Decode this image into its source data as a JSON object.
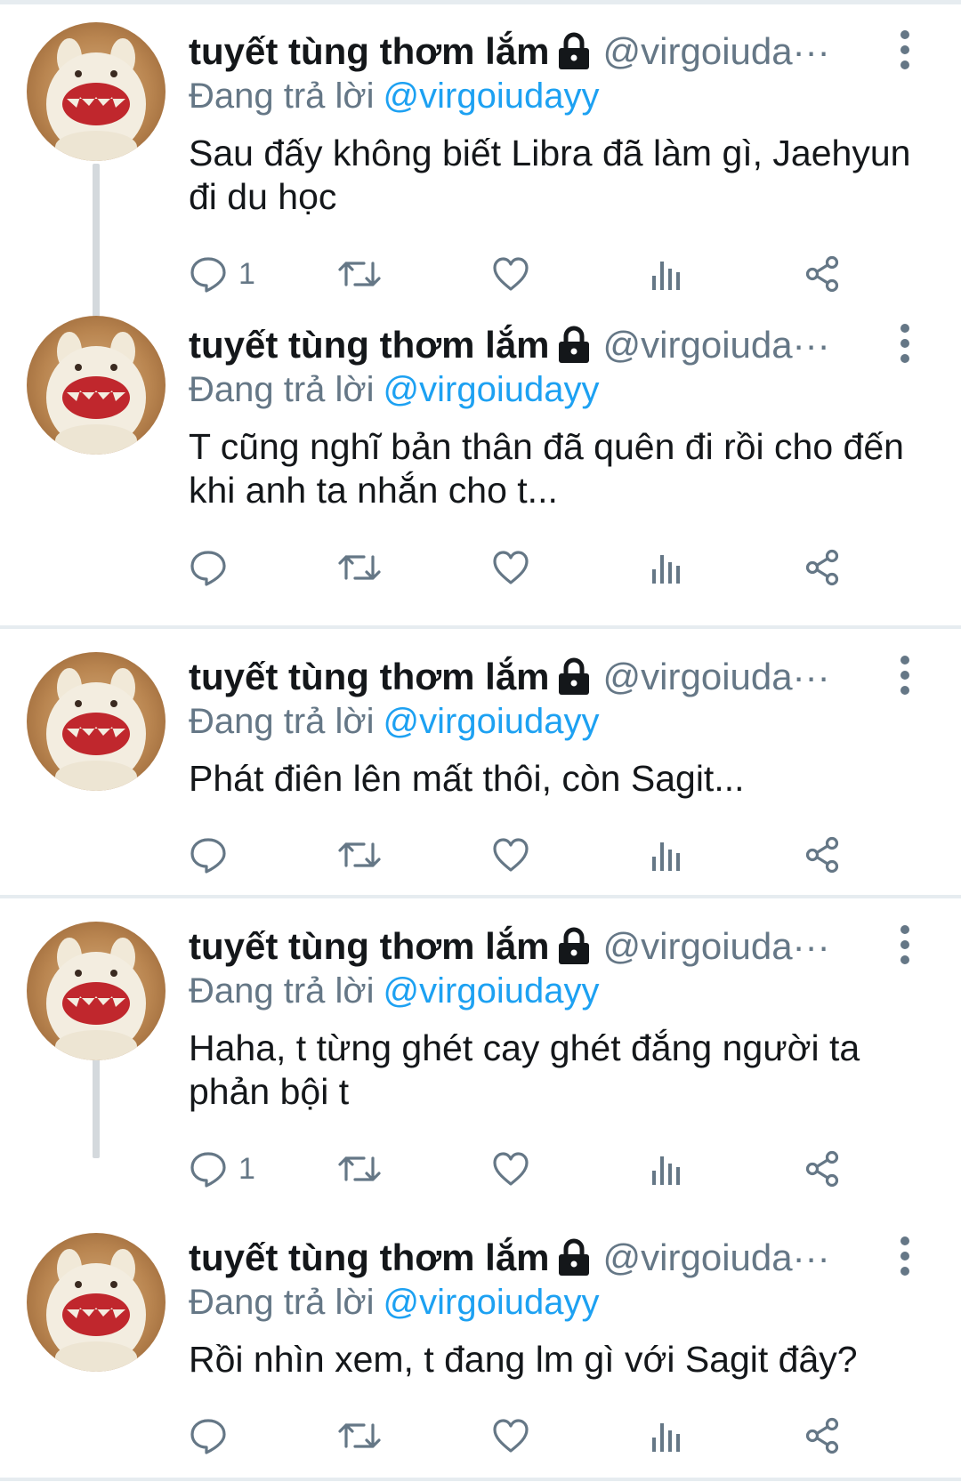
{
  "tweets": [
    {
      "name": "tuyết tùng thơm lắm",
      "handle": "@virgoiuda···",
      "reply_prefix": "Đang trả lời",
      "reply_mention": "@virgoiudayy",
      "text": "Sau đấy không biết Libra đã làm gì, Jaehyun đi du học",
      "reply_count": "1"
    },
    {
      "name": "tuyết tùng thơm lắm",
      "handle": "@virgoiuda···",
      "reply_prefix": "Đang trả lời",
      "reply_mention": "@virgoiudayy",
      "text": "T cũng nghĩ bản thân đã quên đi rồi cho đến khi anh ta nhắn cho t...",
      "reply_count": ""
    },
    {
      "name": "tuyết tùng thơm lắm",
      "handle": "@virgoiuda···",
      "reply_prefix": "Đang trả lời",
      "reply_mention": "@virgoiudayy",
      "text": "Phát điên lên mất thôi, còn Sagit...",
      "reply_count": ""
    },
    {
      "name": "tuyết tùng thơm lắm",
      "handle": "@virgoiuda···",
      "reply_prefix": "Đang trả lời",
      "reply_mention": "@virgoiudayy",
      "text": "Haha, t từng ghét cay ghét đắng người ta phản bội t",
      "reply_count": "1"
    },
    {
      "name": "tuyết tùng thơm lắm",
      "handle": "@virgoiuda···",
      "reply_prefix": "Đang trả lời",
      "reply_mention": "@virgoiudayy",
      "text": "Rồi nhìn xem, t đang lm gì với Sagit đây?",
      "reply_count": ""
    }
  ],
  "icons": {
    "lock": "lock-icon",
    "more": "more-vertical-icon",
    "reply": "reply-icon",
    "retweet": "retweet-icon",
    "like": "heart-icon",
    "analytics": "analytics-icon",
    "share": "share-icon"
  },
  "colors": {
    "text": "#14171a",
    "secondary": "#657786",
    "mention": "#1da1f2",
    "divider": "#e6ecf0",
    "thread_line": "#d4d9dd"
  }
}
